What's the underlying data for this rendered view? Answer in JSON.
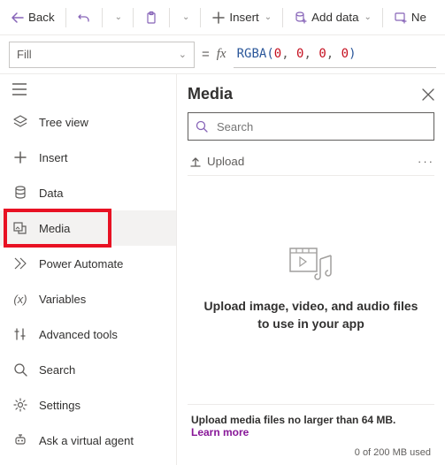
{
  "toolbar": {
    "back_label": "Back",
    "insert_label": "Insert",
    "add_data_label": "Add data",
    "new_label": "Ne"
  },
  "formula_bar": {
    "property": "Fill",
    "fn": "RGBA",
    "args": [
      "0",
      "0",
      "0",
      "0"
    ]
  },
  "sidebar": {
    "items": [
      {
        "icon": "tree",
        "label": "Tree view"
      },
      {
        "icon": "plus",
        "label": "Insert"
      },
      {
        "icon": "data",
        "label": "Data"
      },
      {
        "icon": "media",
        "label": "Media",
        "selected": true,
        "highlighted": true
      },
      {
        "icon": "flow",
        "label": "Power Automate"
      },
      {
        "icon": "var",
        "label": "Variables"
      },
      {
        "icon": "tools",
        "label": "Advanced tools"
      },
      {
        "icon": "search",
        "label": "Search"
      },
      {
        "icon": "gear",
        "label": "Settings"
      },
      {
        "icon": "bot",
        "label": "Ask a virtual agent"
      }
    ]
  },
  "panel": {
    "title": "Media",
    "search_placeholder": "Search",
    "upload_label": "Upload",
    "empty_text": "Upload image, video, and audio files to use in your app",
    "footer_text": "Upload media files no larger than 64 MB.",
    "footer_link": "Learn more",
    "usage_text": "0 of 200 MB used"
  }
}
